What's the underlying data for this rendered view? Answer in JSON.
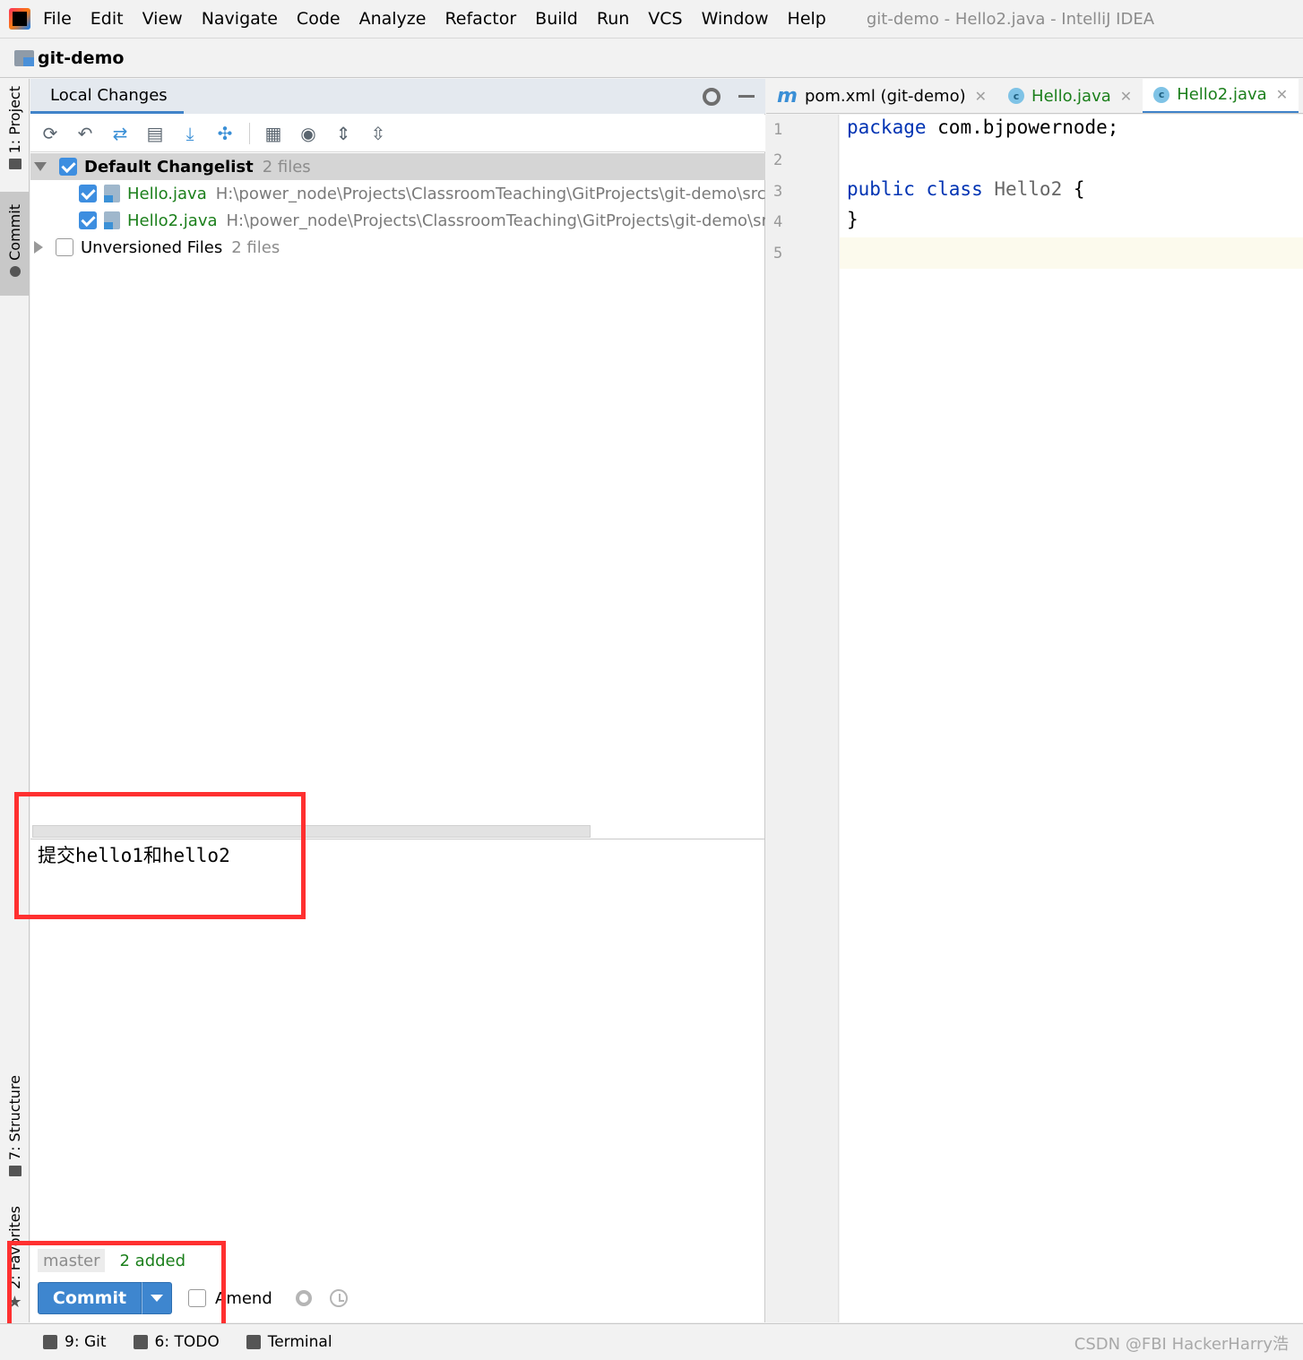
{
  "menubar": {
    "items": [
      "File",
      "Edit",
      "View",
      "Navigate",
      "Code",
      "Analyze",
      "Refactor",
      "Build",
      "Run",
      "VCS",
      "Window",
      "Help"
    ],
    "window_title": "git-demo - Hello2.java - IntelliJ IDEA"
  },
  "navbar": {
    "project": "git-demo"
  },
  "left_stripe": {
    "project": "1: Project",
    "commit": "Commit",
    "structure": "7: Structure",
    "favorites": "2: Favorites"
  },
  "commit_panel": {
    "tab": "Local Changes",
    "tree": {
      "default_changelist": {
        "name": "Default Changelist",
        "count": "2 files"
      },
      "files": [
        {
          "name": "Hello.java",
          "path": "H:\\power_node\\Projects\\ClassroomTeaching\\GitProjects\\git-demo\\src\\m"
        },
        {
          "name": "Hello2.java",
          "path": "H:\\power_node\\Projects\\ClassroomTeaching\\GitProjects\\git-demo\\src\\"
        }
      ],
      "unversioned": {
        "name": "Unversioned Files",
        "count": "2 files"
      }
    },
    "commit_message": "提交hello1和hello2",
    "branch": "master",
    "changes_summary": "2 added",
    "commit_label": "Commit",
    "amend_label": "Amend"
  },
  "editor": {
    "tabs": [
      {
        "label": "pom.xml (git-demo)"
      },
      {
        "label": "Hello.java"
      },
      {
        "label": "Hello2.java"
      }
    ],
    "line_numbers": [
      "1",
      "2",
      "3",
      "4",
      "5"
    ],
    "code": {
      "l1_kw": "package",
      "l1_rest": " com.bjpowernode;",
      "l3_kw": "public class",
      "l3_cls": " Hello2",
      "l3_rest": " {",
      "l4": "}"
    }
  },
  "statusbar": {
    "git": "9: Git",
    "todo": "6: TODO",
    "terminal": "Terminal",
    "watermark": "CSDN @FBI HackerHarry浩"
  },
  "colors": {
    "accent": "#3e86cf",
    "added_green": "#1b7f1b",
    "highlight_red": "#ff3030"
  }
}
